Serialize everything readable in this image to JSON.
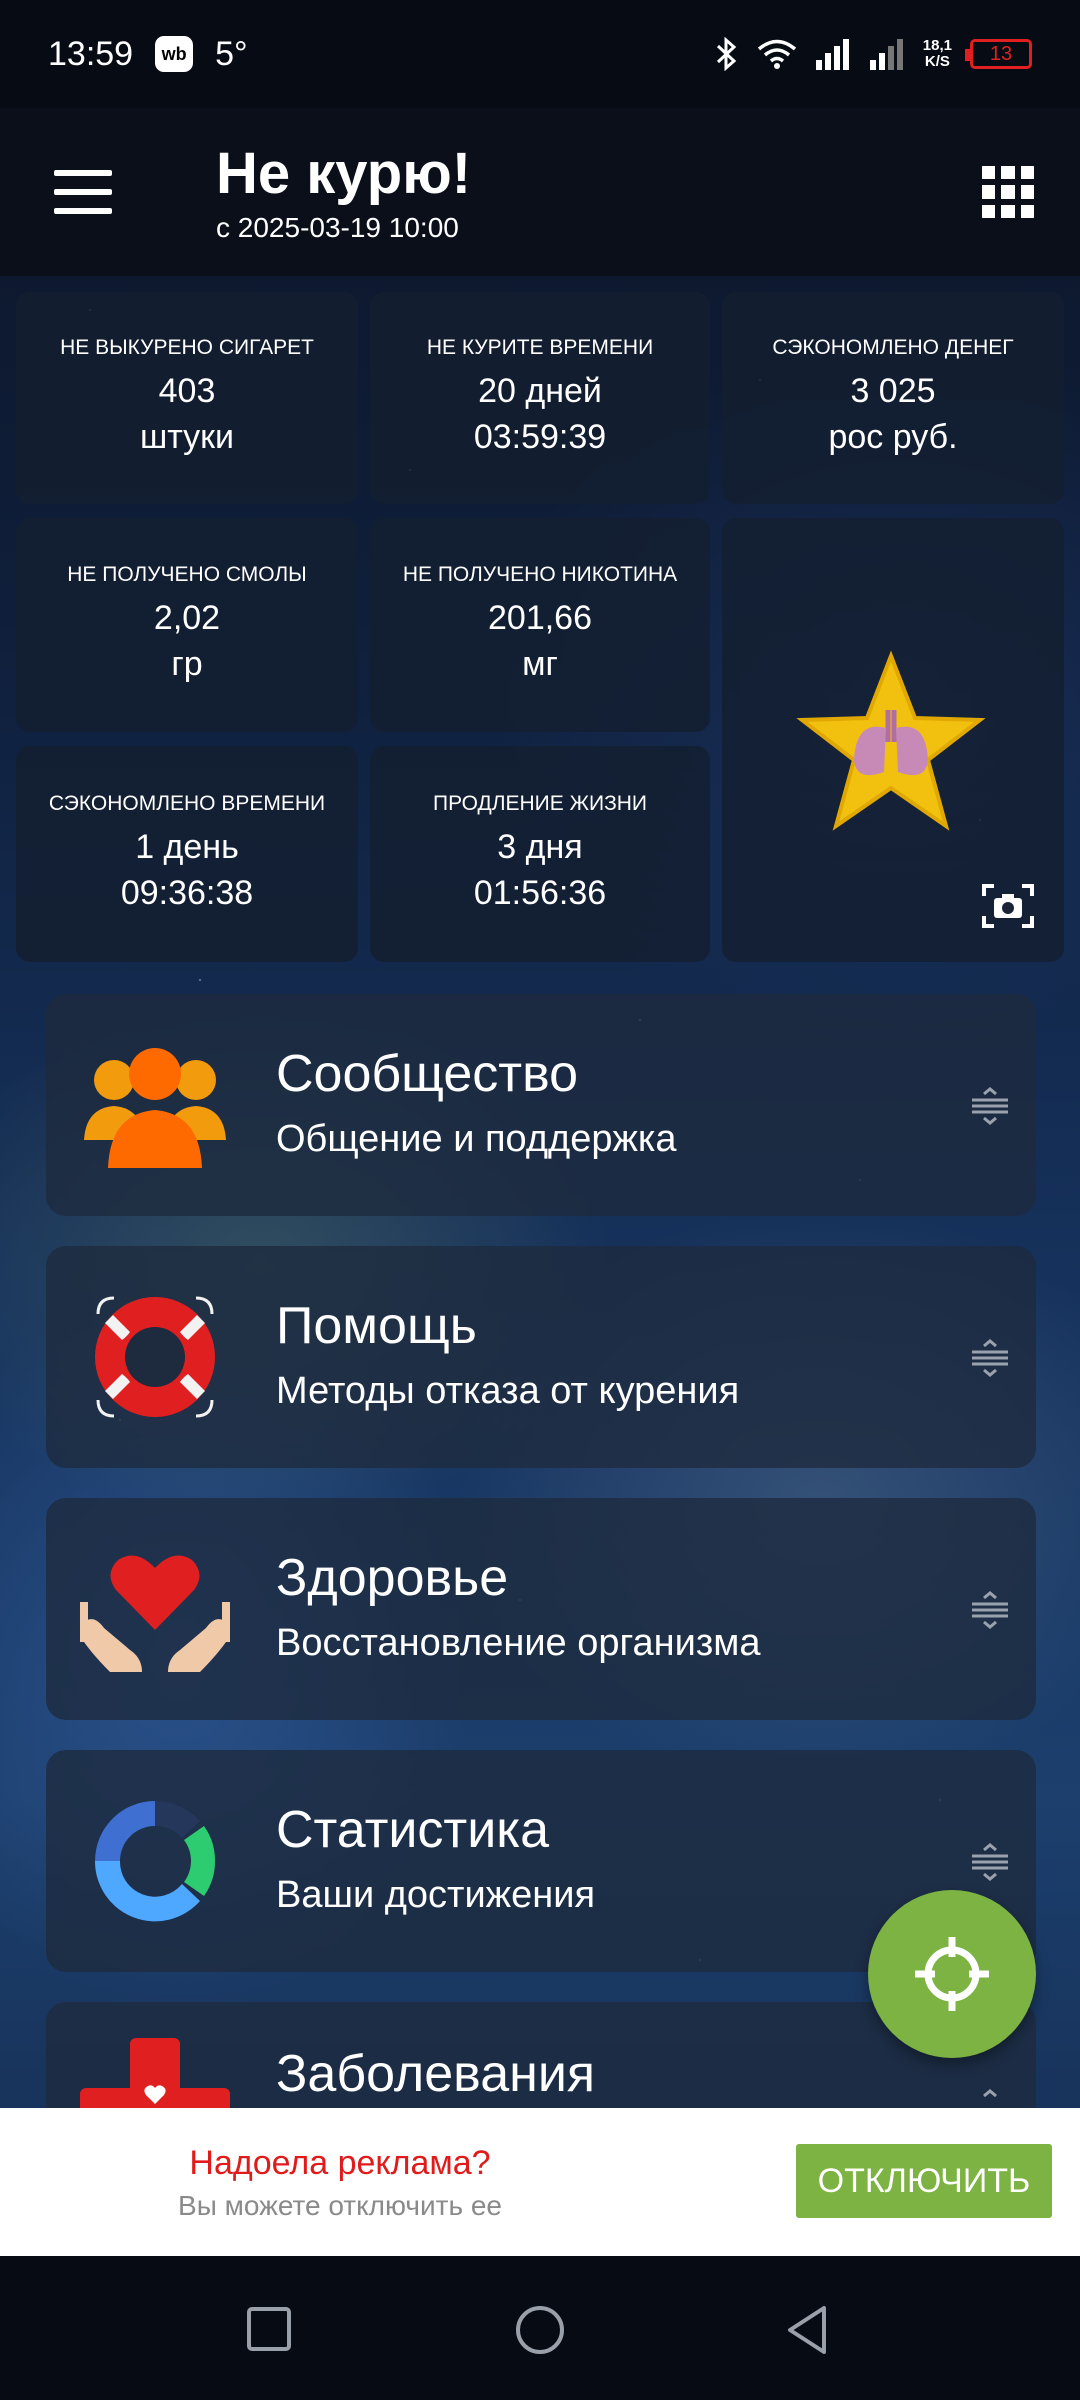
{
  "status_bar": {
    "time": "13:59",
    "wb": "wb",
    "temp": "5°",
    "speed_value": "18,1",
    "speed_unit": "K/S",
    "battery": "13"
  },
  "app_bar": {
    "title": "Не курю!",
    "subtitle": "с 2025-03-19 10:00"
  },
  "stats": [
    {
      "label": "НЕ ВЫКУРЕНО СИГАРЕТ",
      "value": "403",
      "unit": "штуки"
    },
    {
      "label": "НЕ КУРИТЕ ВРЕМЕНИ",
      "value": "20 дней",
      "unit": "03:59:39"
    },
    {
      "label": "СЭКОНОМЛЕНО ДЕНЕГ",
      "value": "3 025",
      "unit": "рос руб."
    },
    {
      "label": "НЕ ПОЛУЧЕНО СМОЛЫ",
      "value": "2,02",
      "unit": "гр"
    },
    {
      "label": "НЕ ПОЛУЧЕНО НИКОТИНА",
      "value": "201,66",
      "unit": "мг"
    },
    {
      "label": "СЭКОНОМЛЕНО ВРЕМЕНИ",
      "value": "1 день",
      "unit": "09:36:38"
    },
    {
      "label": "ПРОДЛЕНИЕ ЖИЗНИ",
      "value": "3 дня",
      "unit": "01:56:36"
    }
  ],
  "menu": [
    {
      "title": "Сообщество",
      "subtitle": "Общение и поддержка",
      "icon": "community-icon"
    },
    {
      "title": "Помощь",
      "subtitle": "Методы отказа от курения",
      "icon": "lifebuoy-icon"
    },
    {
      "title": "Здоровье",
      "subtitle": "Восстановление организма",
      "icon": "heart-hands-icon"
    },
    {
      "title": "Статистика",
      "subtitle": "Ваши достижения",
      "icon": "donut-chart-icon"
    },
    {
      "title": "Заболевания",
      "subtitle": "",
      "icon": "medical-cross-icon"
    }
  ],
  "ad": {
    "title": "Надоела реклама?",
    "subtitle": "Вы можете отключить ее",
    "button": "ОТКЛЮЧИТЬ"
  },
  "colors": {
    "accent": "#7cb342",
    "ad_title": "#e01b1b",
    "battery": "#e02020"
  }
}
